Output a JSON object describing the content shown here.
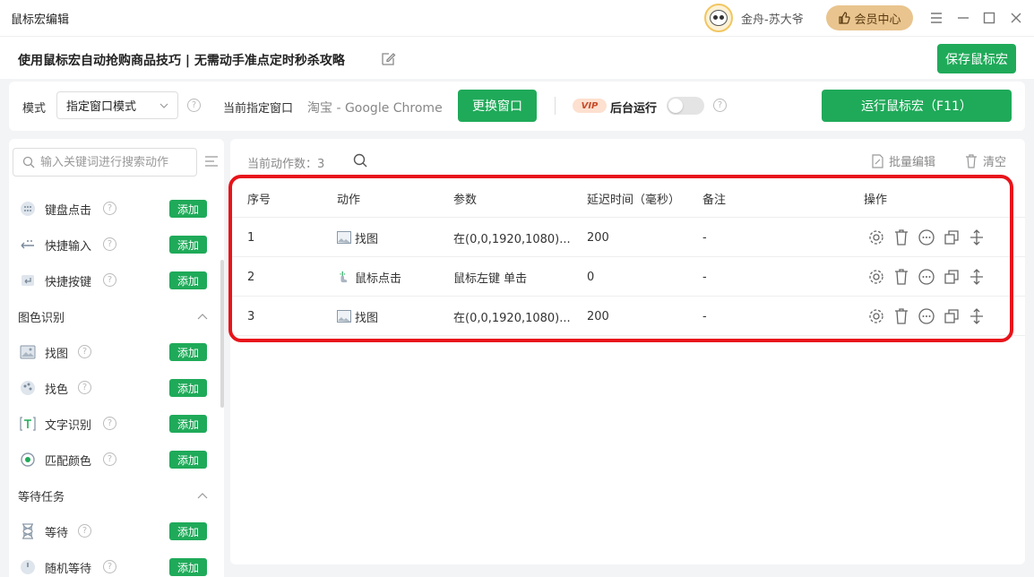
{
  "app": {
    "title": "鼠标宏编辑",
    "user_name": "金舟-苏大爷",
    "vip_center": "会员中心"
  },
  "header": {
    "title": "使用鼠标宏自动抢购商品技巧 | 无需动手准点定时秒杀攻略",
    "save_label": "保存鼠标宏"
  },
  "toolbar": {
    "mode_label": "模式",
    "mode_value": "指定窗口模式",
    "window_label": "当前指定窗口",
    "window_value": "淘宝 - Google Chrome",
    "switch_label": "更换窗口",
    "vip_tag": "VIP",
    "bg_run_label": "后台运行",
    "run_label": "运行鼠标宏（F11）"
  },
  "sidebar": {
    "search_placeholder": "输入关键词进行搜索动作",
    "add_label": "添加",
    "items_top": [
      {
        "label": "键盘点击",
        "icon": "keyboard-icon"
      },
      {
        "label": "快捷输入",
        "icon": "input-icon"
      },
      {
        "label": "快捷按键",
        "icon": "enter-key-icon"
      }
    ],
    "group_image": "图色识别",
    "items_image": [
      {
        "label": "找图",
        "icon": "image-icon"
      },
      {
        "label": "找色",
        "icon": "palette-icon"
      },
      {
        "label": "文字识别",
        "icon": "text-icon"
      },
      {
        "label": "匹配颜色",
        "icon": "match-color-icon"
      }
    ],
    "group_wait": "等待任务",
    "items_wait": [
      {
        "label": "等待",
        "icon": "hourglass-icon"
      },
      {
        "label": "随机等待",
        "icon": "random-wait-icon"
      }
    ]
  },
  "main": {
    "count_label": "当前动作数：3",
    "batch_edit": "批量编辑",
    "clear": "清空",
    "columns": [
      "序号",
      "动作",
      "参数",
      "延迟时间（毫秒）",
      "备注",
      "操作"
    ],
    "rows": [
      {
        "index": "1",
        "action": "找图",
        "param": "在(0,0,1920,1080)...",
        "delay": "200",
        "note": "-"
      },
      {
        "index": "2",
        "action": "鼠标点击",
        "param": "鼠标左键 单击",
        "delay": "0",
        "note": "-"
      },
      {
        "index": "3",
        "action": "找图",
        "param": "在(0,0,1920,1080)...",
        "delay": "200",
        "note": "-"
      }
    ]
  },
  "colors": {
    "accent": "#1faa59",
    "highlight": "#e8141b",
    "vip": "#e9c48e"
  }
}
